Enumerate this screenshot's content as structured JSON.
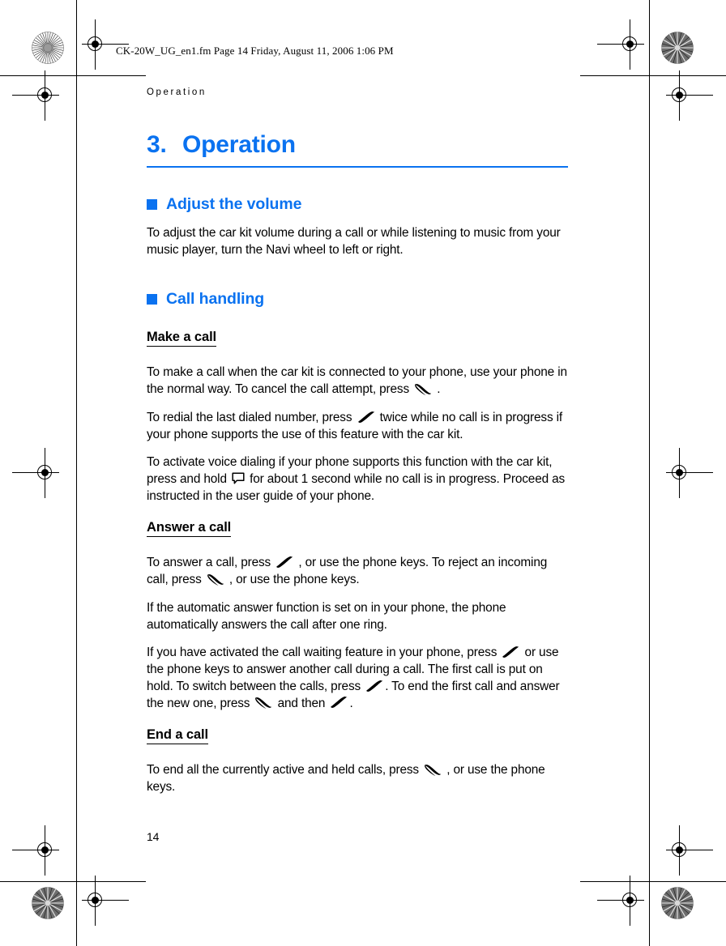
{
  "print_marks": {
    "filename_banner": "CK-20W_UG_en1.fm  Page 14  Friday, August 11, 2006  1:06 PM",
    "registration_target_name": "registration-target",
    "color_star_target_name": "color-star-target"
  },
  "colors": {
    "heading_blue": "#0a72f0",
    "body_black": "#000000",
    "page_background": "#ffffff"
  },
  "running_head": "Operation",
  "chapter": {
    "number": "3.",
    "title": "Operation"
  },
  "sections": [
    {
      "id": "adjust-the-volume",
      "heading": "Adjust the volume",
      "paragraphs": [
        "To adjust the car kit volume during a call or while listening to music from your music player, turn the Navi wheel to left or right."
      ]
    },
    {
      "id": "call-handling",
      "heading": "Call handling",
      "subsections": [
        {
          "id": "make-a-call",
          "heading": "Make a call",
          "paragraphs": [
            {
              "parts": [
                {
                  "type": "text",
                  "value": "To make a call when the car kit is connected to your phone, use your phone in the normal way. To cancel the call attempt, press "
                },
                {
                  "type": "icon",
                  "value": "end-call-key-icon"
                },
                {
                  "type": "text",
                  "value": " ."
                }
              ]
            },
            {
              "parts": [
                {
                  "type": "text",
                  "value": "To redial the last dialed number, press "
                },
                {
                  "type": "icon",
                  "value": "send-call-key-icon"
                },
                {
                  "type": "text",
                  "value": " twice while no call is in progress if your phone supports the use of this feature with the car kit."
                }
              ]
            },
            {
              "parts": [
                {
                  "type": "text",
                  "value": "To activate voice dialing if your phone supports this function with the car kit, press and hold "
                },
                {
                  "type": "icon",
                  "value": "voice-dial-key-icon"
                },
                {
                  "type": "text",
                  "value": " for about 1 second while no call is in progress. Proceed as instructed in the user guide of your phone."
                }
              ]
            }
          ]
        },
        {
          "id": "answer-a-call",
          "heading": "Answer a call",
          "paragraphs": [
            {
              "parts": [
                {
                  "type": "text",
                  "value": "To answer a call, press "
                },
                {
                  "type": "icon",
                  "value": "send-call-key-icon"
                },
                {
                  "type": "text",
                  "value": " , or use the phone keys. To reject an incoming call, press "
                },
                {
                  "type": "icon",
                  "value": "end-call-key-icon"
                },
                {
                  "type": "text",
                  "value": " , or use the phone keys."
                }
              ]
            },
            {
              "parts": [
                {
                  "type": "text",
                  "value": "If the automatic answer function is set on in your phone, the phone automatically answers the call after one ring."
                }
              ]
            },
            {
              "parts": [
                {
                  "type": "text",
                  "value": "If you have activated the call waiting feature in your phone, press "
                },
                {
                  "type": "icon",
                  "value": "send-call-key-icon"
                },
                {
                  "type": "text",
                  "value": " or use the phone keys to answer another call during a call. The first call is put on hold. To switch between the calls, press "
                },
                {
                  "type": "icon",
                  "value": "send-call-key-icon"
                },
                {
                  "type": "text",
                  "value": ". To end the first call and answer the new one, press "
                },
                {
                  "type": "icon",
                  "value": "end-call-key-icon"
                },
                {
                  "type": "text",
                  "value": " and then "
                },
                {
                  "type": "icon",
                  "value": "send-call-key-icon"
                },
                {
                  "type": "text",
                  "value": "."
                }
              ]
            }
          ]
        },
        {
          "id": "end-a-call",
          "heading": "End a call",
          "paragraphs": [
            {
              "parts": [
                {
                  "type": "text",
                  "value": "To end all the currently active and held calls, press "
                },
                {
                  "type": "icon",
                  "value": "end-call-key-icon"
                },
                {
                  "type": "text",
                  "value": " , or use the phone keys."
                }
              ]
            }
          ]
        }
      ]
    }
  ],
  "folio": "14"
}
